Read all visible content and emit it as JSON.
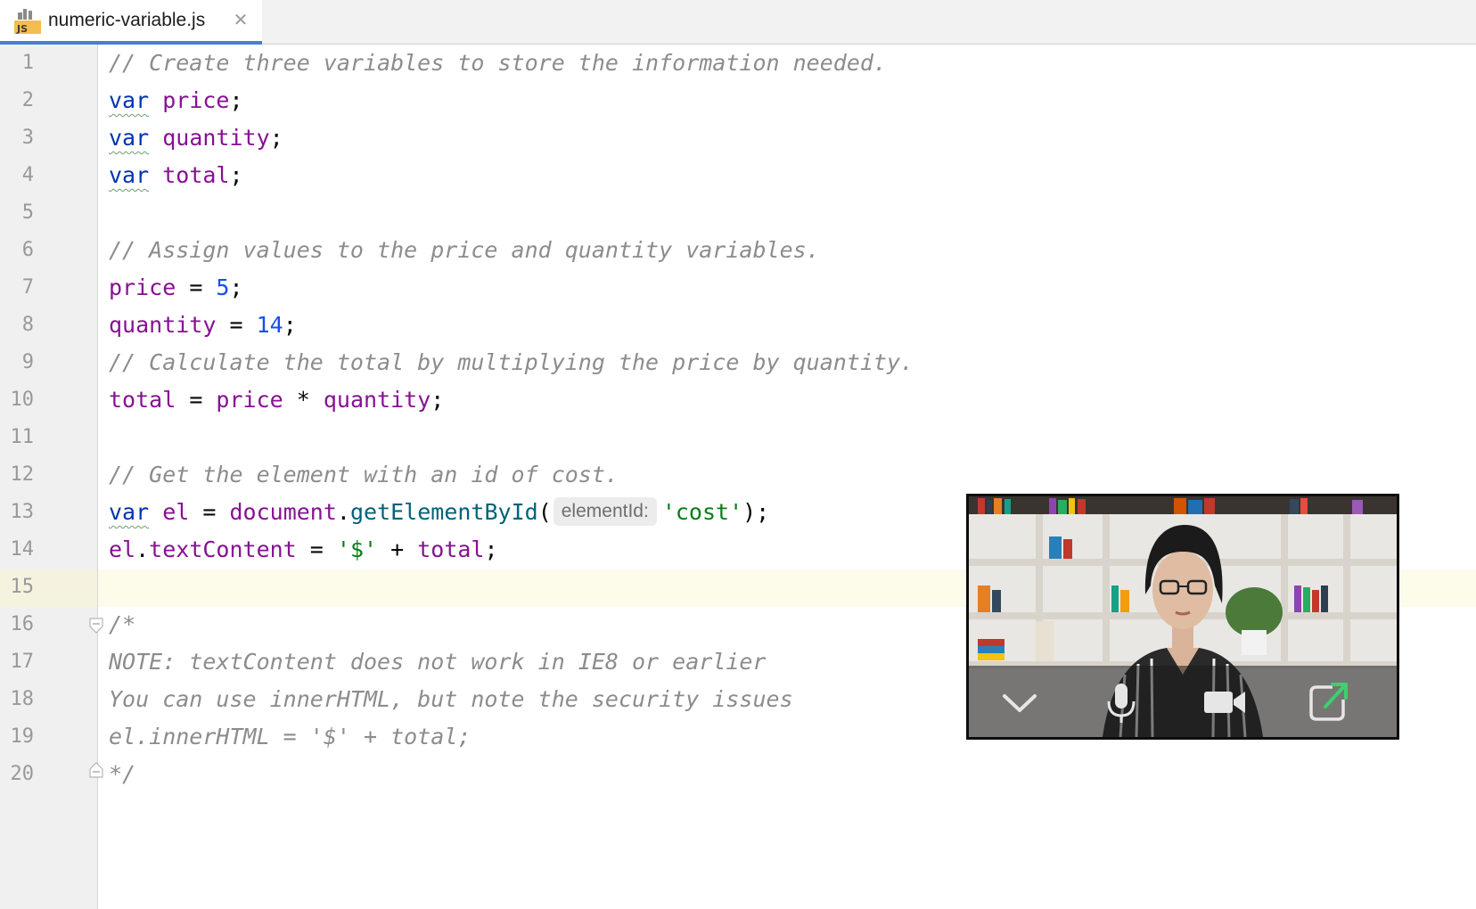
{
  "tab": {
    "filename": "numeric-variable.js",
    "icon": "js-file-icon",
    "close_glyph": "✕"
  },
  "gutter": {
    "line_numbers": [
      "1",
      "2",
      "3",
      "4",
      "5",
      "6",
      "7",
      "8",
      "9",
      "10",
      "11",
      "12",
      "13",
      "14",
      "15",
      "16",
      "17",
      "18",
      "19",
      "20"
    ],
    "current_line": 15
  },
  "code": {
    "l1": "// Create three variables to store the information needed.",
    "l2_kw": "var",
    "l2_var": "price",
    "l2_end": ";",
    "l3_kw": "var",
    "l3_var": "quantity",
    "l3_end": ";",
    "l4_kw": "var",
    "l4_var": "total",
    "l4_end": ";",
    "l6": "// Assign values to the price and quantity variables.",
    "l7_var": "price",
    "l7_op": " = ",
    "l7_num": "5",
    "l7_end": ";",
    "l8_var": "quantity",
    "l8_op": " = ",
    "l8_num": "14",
    "l8_end": ";",
    "l9": "// Calculate the total by multiplying the price by quantity.",
    "l10_a": "total",
    "l10_op1": " = ",
    "l10_b": "price",
    "l10_op2": " * ",
    "l10_c": "quantity",
    "l10_end": ";",
    "l12": "// Get the element with an id of cost.",
    "l13_kw": "var",
    "l13_var": "el",
    "l13_op": " = ",
    "l13_obj": "document",
    "l13_dot": ".",
    "l13_fn": "getElementById",
    "l13_open": "(",
    "l13_hint": "elementId:",
    "l13_str": "'cost'",
    "l13_end": ");",
    "l14_a": "el",
    "l14_dot": ".",
    "l14_prop": "textContent",
    "l14_op": " = ",
    "l14_str": "'$'",
    "l14_plus": " + ",
    "l14_b": "total",
    "l14_end": ";",
    "l16": "/*",
    "l17": "NOTE: textContent does not work in IE8 or earlier",
    "l18": "You can use innerHTML, but note the security issues",
    "l19": "el.innerHTML = '$' + total;",
    "l20": "*/"
  },
  "video_overlay": {
    "controls": [
      "chevron-down-icon",
      "microphone-icon",
      "camera-icon",
      "pop-out-icon"
    ]
  },
  "colors": {
    "keyword": "#0033b3",
    "variable": "#871094",
    "number": "#1750eb",
    "string": "#067d17",
    "comment": "#8c8c8c",
    "tab_accent": "#4a7fcb",
    "pop_out_accent": "#3cd070"
  }
}
